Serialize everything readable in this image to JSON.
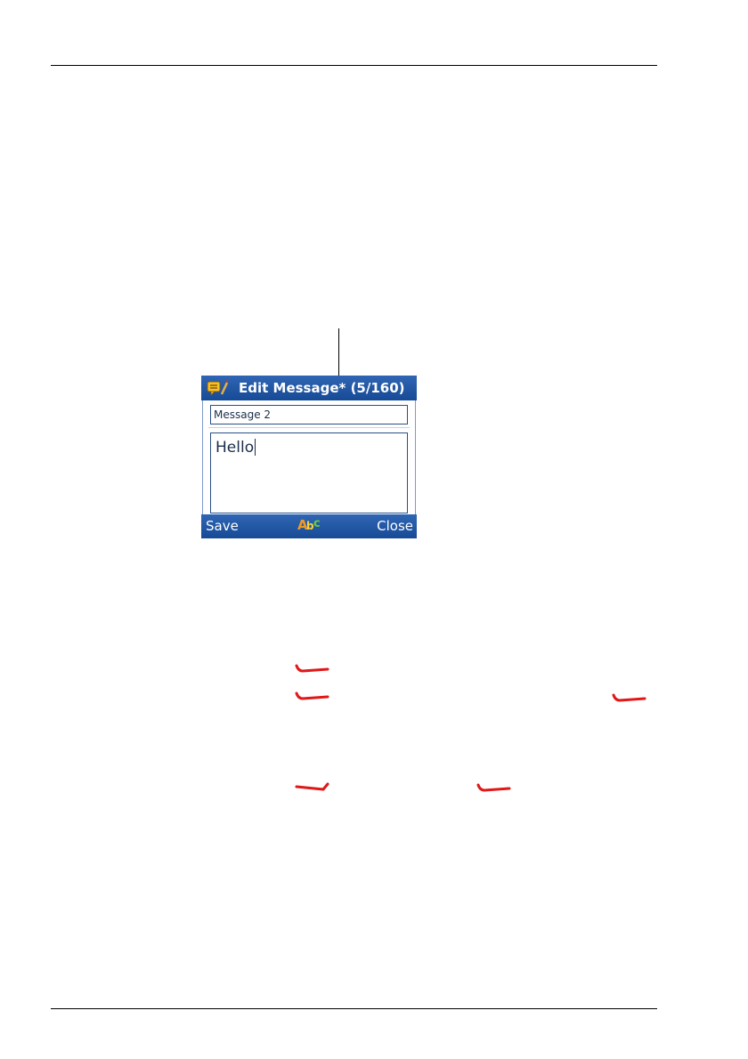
{
  "dialog": {
    "title": "Edit Message* (5/160)",
    "name_value": "Message 2",
    "text_value": "Hello",
    "softkeys": {
      "left": "Save",
      "right": "Close",
      "input_mode": {
        "a": "A",
        "b": "b",
        "c": "c"
      }
    }
  },
  "icons": {
    "title_icon": "message-edit-icon",
    "annotation_mark": "red-ink-mark"
  },
  "colors": {
    "bar_blue": "#1f55a3",
    "ink_red": "#e01818",
    "abc_orange": "#f29a1f",
    "abc_yellow": "#f4d23a",
    "abc_green": "#6ccb3a"
  }
}
